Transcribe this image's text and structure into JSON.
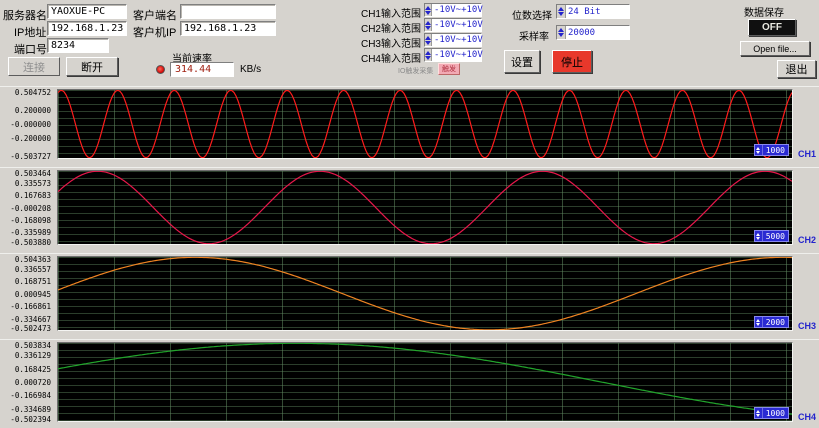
{
  "header": {
    "server_name_label": "服务器名",
    "server_name_value": "YAOXUE-PC",
    "server_ip_label": "IP地址",
    "server_ip_value": "192.168.1.23",
    "port_label": "端口号",
    "port_value": "8234",
    "client_name_label": "客户端名",
    "client_name_value": "",
    "client_ip_label": "客户机IP",
    "client_ip_value": "192.168.1.23",
    "connect_label": "连接",
    "disconnect_label": "断开",
    "rate_label": "当前速率",
    "rate_value": "314.44",
    "rate_unit": "KB/s"
  },
  "ranges": {
    "items": [
      {
        "label": "CH1输入范围",
        "value": "-10V~+10V"
      },
      {
        "label": "CH2输入范围",
        "value": "-10V~+10V"
      },
      {
        "label": "CH3输入范围",
        "value": "-10V~+10V"
      },
      {
        "label": "CH4输入范围",
        "value": "-10V~+10V"
      }
    ],
    "io_trigger_label": "IO触发采集",
    "io_trigger_button": "触发"
  },
  "acquisition": {
    "bits_label": "位数选择",
    "bits_value": "24 Bit",
    "sample_label": "采样率",
    "sample_value": "20000"
  },
  "actions": {
    "set": "设置",
    "stop": "停止",
    "exit": "退出"
  },
  "saving": {
    "label": "数据保存",
    "state": "OFF",
    "open_file": "Open file..."
  },
  "colors": {
    "stop_bg": "#e8382b",
    "save_bg": "#101010",
    "accent_blue": "#2424cc"
  },
  "chart_data": [
    {
      "type": "line",
      "channel": "CH1",
      "color": "#ff1c1c",
      "scroll_value": "1000",
      "cycles": 13,
      "phase": 1.2,
      "amplitude": 0.5,
      "ylim": [
        -0.503727,
        0.504752
      ],
      "y_labels": [
        "0.504752",
        "0.200000",
        "-0.000000",
        "-0.200000",
        "-0.503727"
      ],
      "y_values": [
        0.504752,
        0.2,
        0.0,
        -0.2,
        -0.503727
      ]
    },
    {
      "type": "line",
      "channel": "CH2",
      "color": "#e8174b",
      "scroll_value": "5000",
      "cycles": 3.3,
      "phase": 0.45,
      "amplitude": 0.5,
      "ylim": [
        -0.50388,
        0.503464
      ],
      "y_labels": [
        "0.503464",
        "0.335573",
        "0.167683",
        "-0.000208",
        "-0.168098",
        "-0.335989",
        "-0.503880"
      ],
      "y_values": [
        0.503464,
        0.335573,
        0.167683,
        -0.000208,
        -0.168098,
        -0.335989,
        -0.50388
      ]
    },
    {
      "type": "line",
      "channel": "CH3",
      "color": "#ef8422",
      "scroll_value": "2000",
      "cycles": 1.25,
      "phase": 0.1,
      "amplitude": 0.5,
      "ylim": [
        -0.502473,
        0.504363
      ],
      "y_labels": [
        "0.504363",
        "0.336557",
        "0.168751",
        "0.000945",
        "-0.166861",
        "-0.334667",
        "-0.502473"
      ],
      "y_values": [
        0.504363,
        0.336557,
        0.168751,
        0.000945,
        -0.166861,
        -0.334667,
        -0.502473
      ]
    },
    {
      "type": "line",
      "channel": "CH4",
      "color": "#22a52c",
      "scroll_value": "1000",
      "cycles": 0.6,
      "phase": 0.35,
      "amplitude": 0.5,
      "ylim": [
        -0.502394,
        0.503834
      ],
      "y_labels": [
        "0.503834",
        "0.336129",
        "0.168425",
        "0.000720",
        "-0.166984",
        "-0.334689",
        "-0.502394"
      ],
      "y_values": [
        0.503834,
        0.336129,
        0.168425,
        0.00072,
        -0.166984,
        -0.334689,
        -0.502394
      ]
    }
  ]
}
